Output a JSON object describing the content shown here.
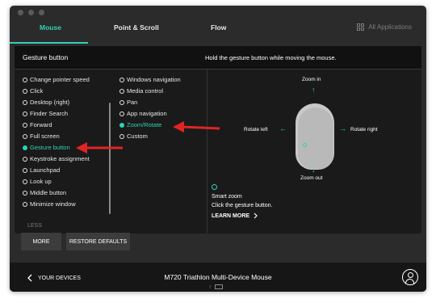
{
  "tabs": [
    {
      "label": "Mouse",
      "active": true
    },
    {
      "label": "Point & Scroll",
      "active": false
    },
    {
      "label": "Flow",
      "active": false
    }
  ],
  "all_applications": "All Applications",
  "panel": {
    "title": "Gesture button",
    "hint": "Hold the gesture button while moving the mouse."
  },
  "button_list": [
    {
      "label": "Change pointer speed",
      "selected": false
    },
    {
      "label": "Click",
      "selected": false
    },
    {
      "label": "Desktop (right)",
      "selected": false
    },
    {
      "label": "Finder Search",
      "selected": false
    },
    {
      "label": "Forward",
      "selected": false
    },
    {
      "label": "Full screen",
      "selected": false
    },
    {
      "label": "Gesture button",
      "selected": true
    },
    {
      "label": "Keystroke assignment",
      "selected": false
    },
    {
      "label": "Launchpad",
      "selected": false
    },
    {
      "label": "Look up",
      "selected": false
    },
    {
      "label": "Middle button",
      "selected": false
    },
    {
      "label": "Minimize window",
      "selected": false
    }
  ],
  "gesture_list": [
    {
      "label": "Windows navigation",
      "selected": false
    },
    {
      "label": "Media control",
      "selected": false
    },
    {
      "label": "Pan",
      "selected": false
    },
    {
      "label": "App navigation",
      "selected": false
    },
    {
      "label": "Zoom/Rotate",
      "selected": true
    },
    {
      "label": "Custom",
      "selected": false
    }
  ],
  "less_label": "LESS",
  "diagram": {
    "zoom_in": "Zoom in",
    "zoom_out": "Zoom out",
    "rotate_left": "Rotate left",
    "rotate_right": "Rotate right",
    "smart_zoom_title": "Smart zoom",
    "smart_zoom_desc": "Click the gesture button.",
    "learn_more": "LEARN MORE"
  },
  "more_button": "MORE",
  "restore_button": "RESTORE DEFAULTS",
  "footer": {
    "back_label": "YOUR DEVICES",
    "device_name": "M720 Triathlon Multi-Device Mouse"
  },
  "colors": {
    "accent": "#2fd3b6",
    "annotation_arrow": "#e02424"
  },
  "icons": [
    "grid-icon",
    "chevron-left-icon",
    "chevron-right-icon",
    "user-icon",
    "bluetooth-icon",
    "battery-icon"
  ]
}
